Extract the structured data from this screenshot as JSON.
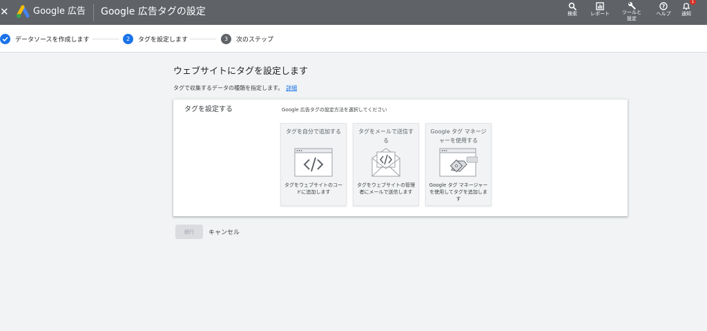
{
  "topbar": {
    "brand": "Google 広告",
    "title": "Google 広告タグの設定",
    "actions": [
      {
        "label": "検索",
        "icon": "search-icon"
      },
      {
        "label": "レポート",
        "icon": "reports-icon"
      },
      {
        "label_line1": "ツールと",
        "label_line2": "設定",
        "icon": "wrench-icon"
      },
      {
        "label": "ヘルプ",
        "icon": "help-icon"
      },
      {
        "label": "通知",
        "icon": "bell-icon",
        "badge": "1"
      }
    ]
  },
  "stepper": {
    "steps": [
      {
        "label": "データソースを作成します",
        "state": "done"
      },
      {
        "number": "2",
        "label": "タグを設定します",
        "state": "active"
      },
      {
        "number": "3",
        "label": "次のステップ",
        "state": "pending"
      }
    ]
  },
  "main": {
    "title": "ウェブサイトにタグを設定します",
    "subtitle": "タグで収集するデータの種類を指定します。",
    "details_link": "詳細",
    "card": {
      "label": "タグを設定する",
      "help": "Google 広告タグの設定方法を選択してください",
      "options": [
        {
          "title": "タグを自分で追加する",
          "desc": "タグをウェブサイトのコードに追加します",
          "icon": "code-window-icon"
        },
        {
          "title": "タグをメールで送信する",
          "desc": "タグをウェブサイトの管理者にメールで送信します",
          "icon": "email-code-icon"
        },
        {
          "title": "Google タグ マネージャーを使用する",
          "desc": "Google タグ マネージャーを使用してタグを追加します",
          "icon": "tag-manager-icon"
        }
      ]
    },
    "continue_label": "続行",
    "cancel_label": "キャンセル"
  },
  "colors": {
    "topbar": "#5f6368",
    "accent": "#1a73e8",
    "page_bg": "#f1f3f4"
  }
}
